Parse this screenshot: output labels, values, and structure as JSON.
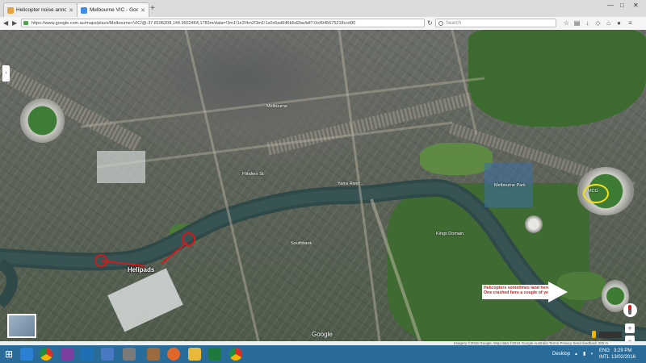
{
  "browser": {
    "tabs": [
      {
        "label": "Helicopter noise annoying...",
        "icon": "page-icon",
        "color": "#e8a33c"
      },
      {
        "label": "Melbourne VIC - Google ...",
        "icon": "google-maps-icon",
        "color": "#3d8ee8"
      }
    ],
    "new_tab": "+",
    "window_controls": [
      "—",
      "□",
      "✕"
    ],
    "url": "https://www.google.com.au/maps/place/Melbourne+VIC/@-37.8196208,144.9652464,1783m/data=!3m1!1e3!4m2!3m1!1s0x6ad646b5d2ba4df7:0x4045675218ccd90",
    "search_placeholder": "Search"
  },
  "map": {
    "annotations": {
      "helipads": "Helipads",
      "note_line1": "Helicopters sometimes land here.",
      "note_line2": "One crashed here a couple of years ago"
    },
    "labels": [
      "Yarra River",
      "Flinders St",
      "Melbourne",
      "Southbank",
      "Kings Domain",
      "Melbourne Park",
      "MCG"
    ],
    "google": "Google",
    "attribution": "Imagery ©2016 Google, Map data ©2016 Google   Australia   Terms   Privacy   Send feedback   200 m"
  },
  "taskbar": {
    "desktop_label": "Desktop",
    "lang": "ENG",
    "region": "INTL",
    "time": "3:29 PM",
    "date": "13/02/2016"
  },
  "colors": {
    "annotation_red": "#d41a1a",
    "annotation_yellow": "#f5e11a",
    "taskbar": "#2a6c99"
  }
}
